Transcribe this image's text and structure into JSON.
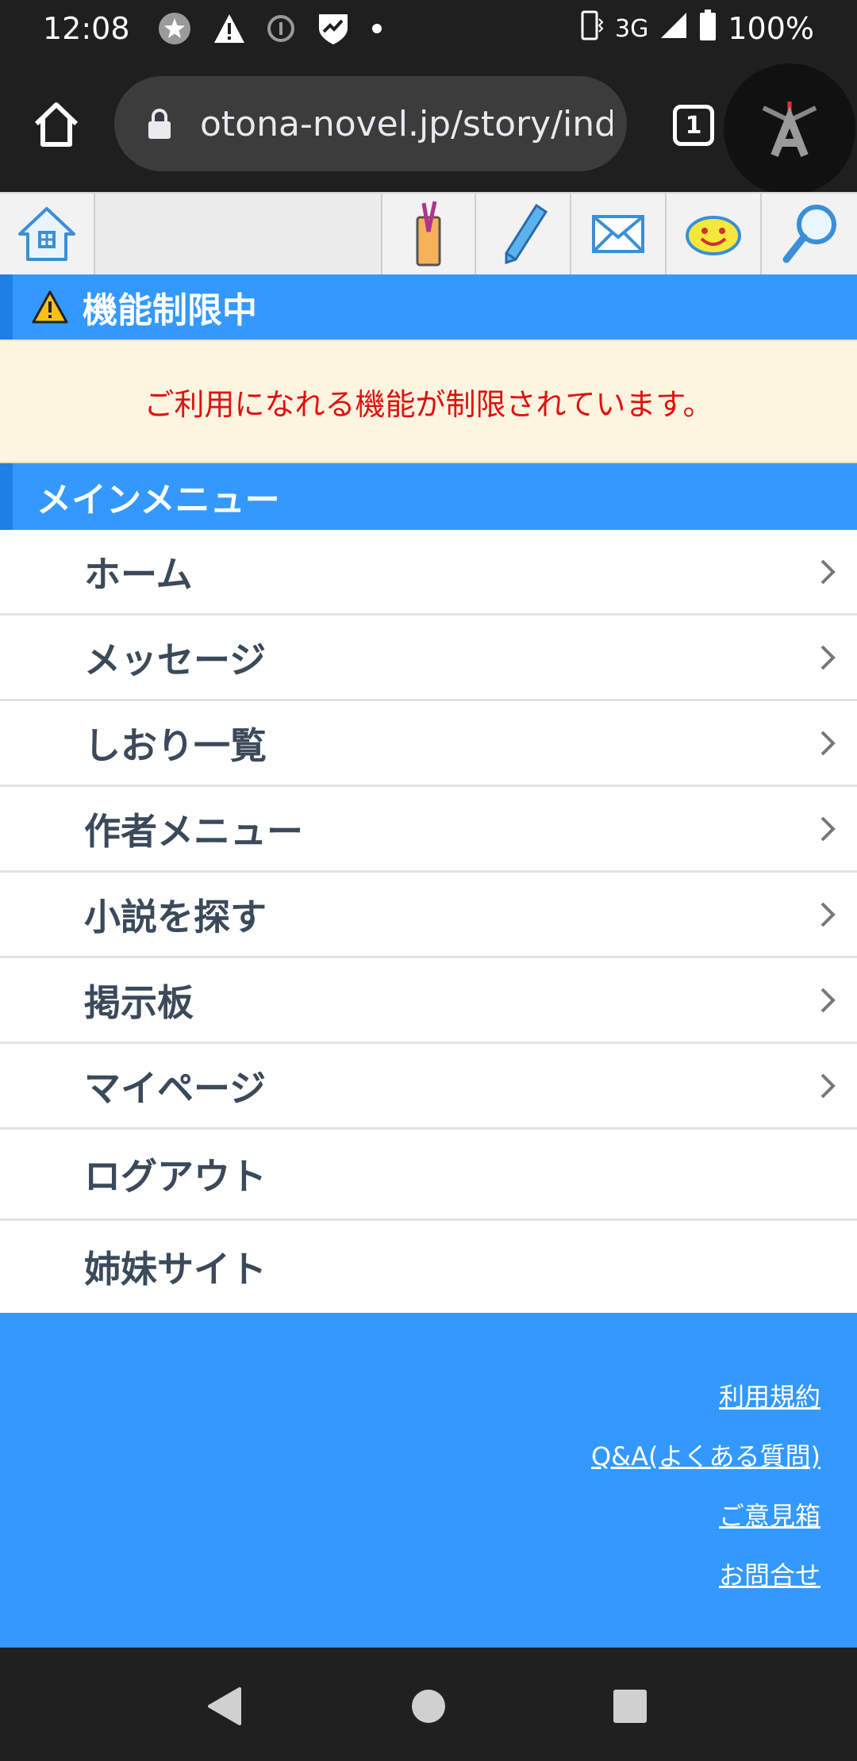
{
  "status_bar": {
    "time": "12:08",
    "network": "3G",
    "battery": "100%"
  },
  "browser": {
    "url": "otona-novel.jp/story/index",
    "tab_count": "1"
  },
  "toolbar": {
    "icons": [
      "house-icon",
      "bookmark-icon",
      "pencil-icon",
      "mail-icon",
      "smiley-icon",
      "magnifier-icon"
    ]
  },
  "notice": {
    "header": "機能制限中",
    "message": "ご利用になれる機能が制限されています。"
  },
  "main_menu": {
    "header": "メインメニュー",
    "items": [
      {
        "label": "ホーム"
      },
      {
        "label": "メッセージ"
      },
      {
        "label": "しおり一覧"
      },
      {
        "label": "作者メニュー"
      },
      {
        "label": "小説を探す"
      },
      {
        "label": "掲示板"
      },
      {
        "label": "マイページ"
      },
      {
        "label": "ログアウト"
      },
      {
        "label": "姉妹サイト"
      }
    ]
  },
  "footer": {
    "links": [
      "利用規約",
      "Q&A(よくある質問)",
      "ご意見箱",
      "お問合せ"
    ]
  },
  "colors": {
    "accent_blue": "#3399ff",
    "notice_text": "#e01010",
    "notice_bg": "#fdf5e0",
    "menu_text": "#3b4a5a"
  }
}
